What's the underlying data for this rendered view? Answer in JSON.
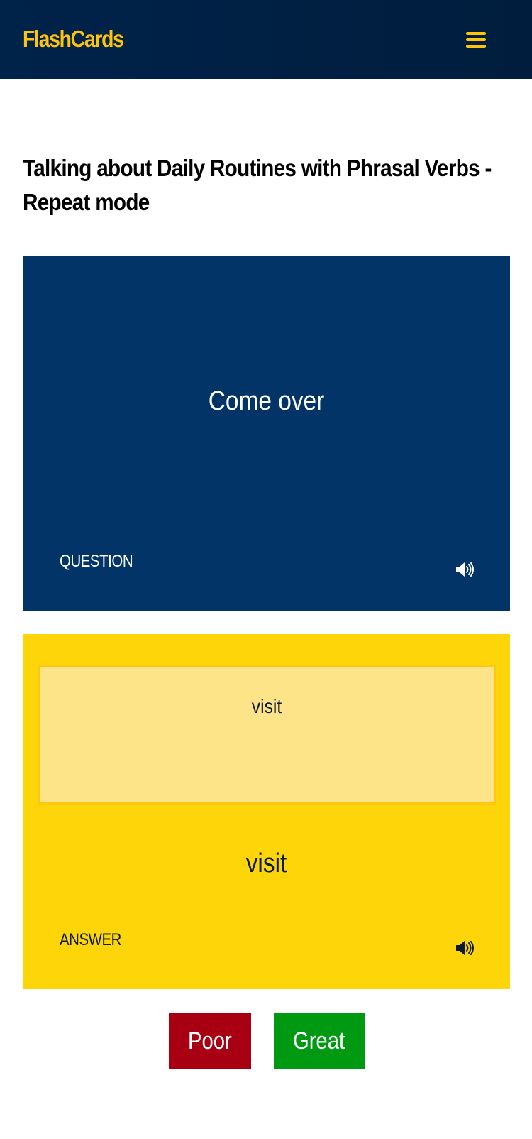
{
  "header": {
    "brand": "FlashCards",
    "menu_icon": "hamburger-menu-icon",
    "background": "#001d3d",
    "accent": "#ffc30b"
  },
  "page": {
    "title": "Talking about Daily Routines with Phrasal Verbs - Repeat mode"
  },
  "question_card": {
    "text": "Come over",
    "label": "QUESTION",
    "icon": "speaker-icon",
    "background": "#023468"
  },
  "answer_card": {
    "input_value": "visit",
    "text": "visit",
    "label": "ANSWER",
    "icon": "speaker-icon",
    "background": "#fed508"
  },
  "actions": {
    "poor_label": "Poor",
    "great_label": "Great",
    "poor_color": "#a80012",
    "great_color": "#009912"
  }
}
